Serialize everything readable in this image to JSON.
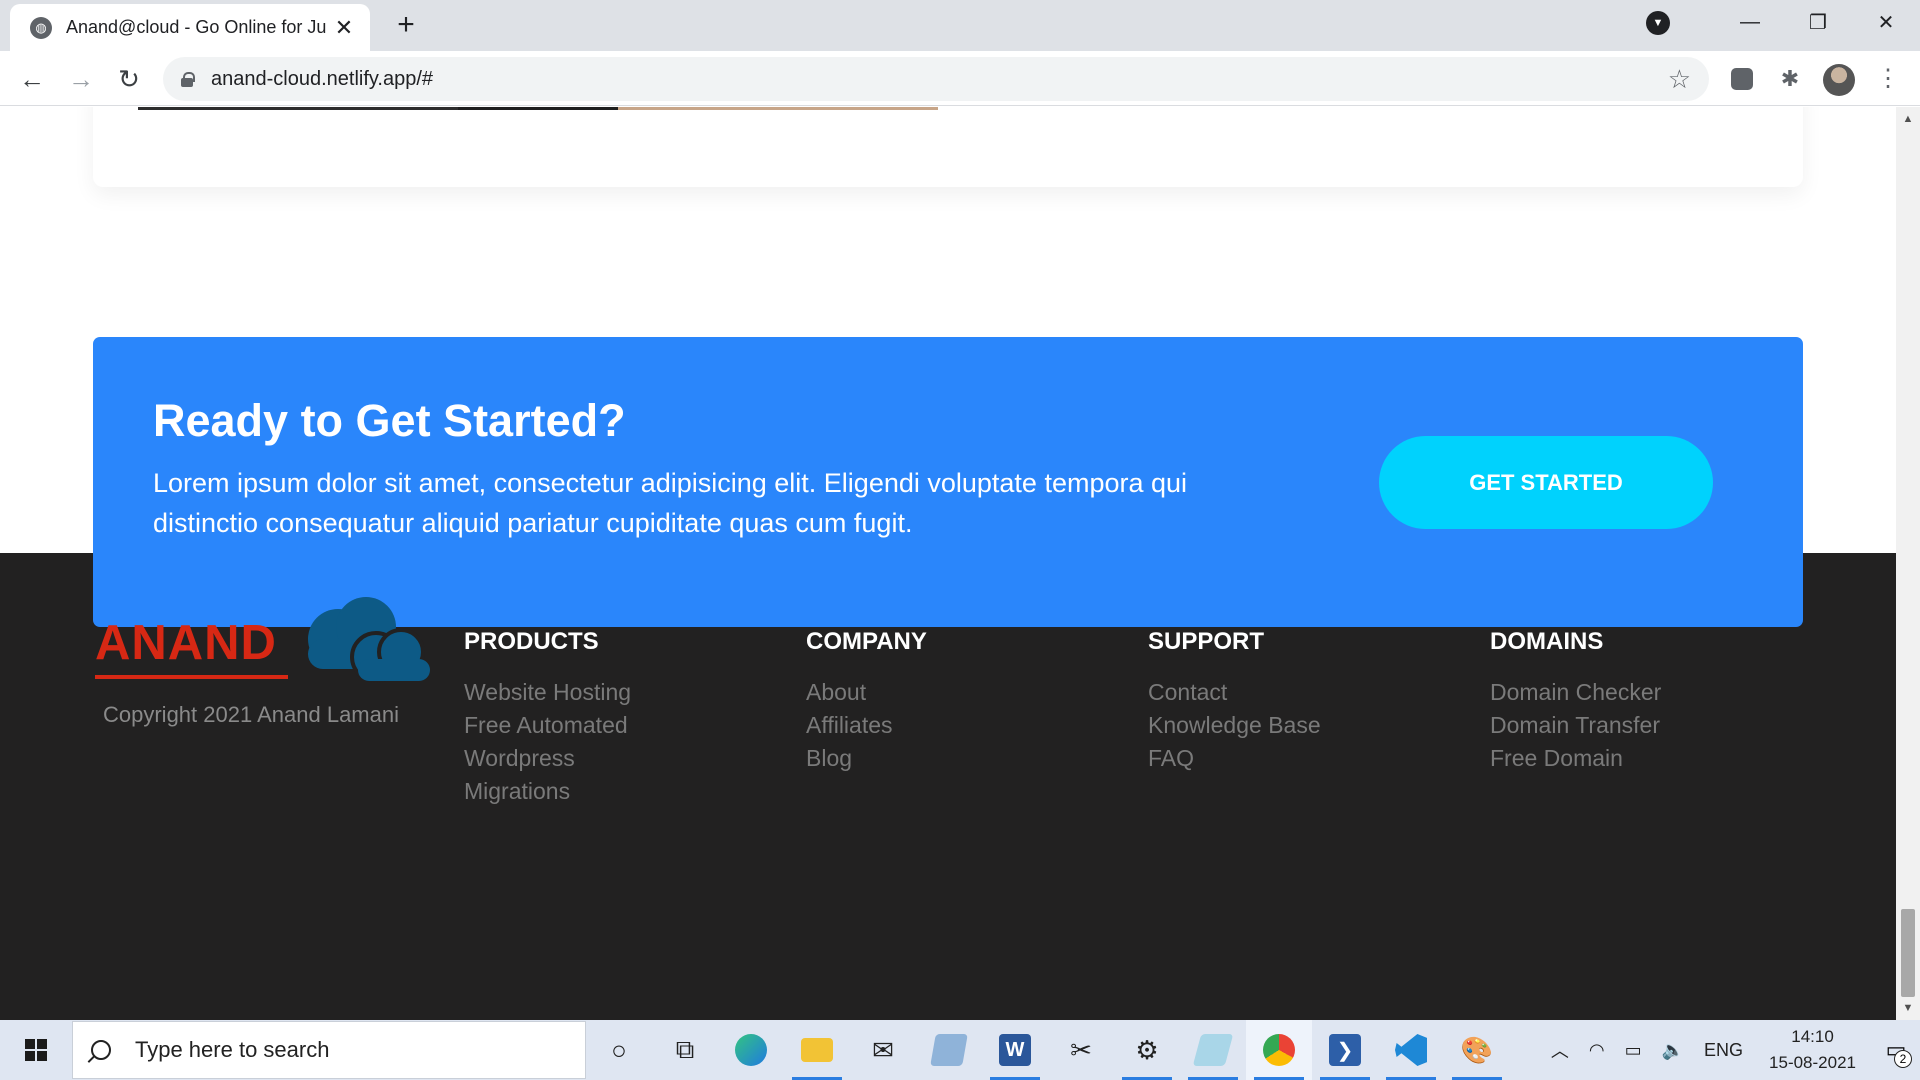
{
  "browser": {
    "tab_title": "Anand@cloud - Go Online for Ju",
    "url": "anand-cloud.netlify.app/#"
  },
  "cta": {
    "title": "Ready to Get Started?",
    "text": "Lorem ipsum dolor sit amet, consectetur adipisicing elit. Eligendi voluptate tempora qui distinctio consequatur aliquid pariatur cupiditate quas cum fugit.",
    "button_label": "GET STARTED"
  },
  "footer": {
    "brand": "ANAND",
    "copyright": "Copyright 2021 Anand Lamani",
    "columns": [
      {
        "heading": "PRODUCTS",
        "links": [
          "Website Hosting",
          "Free Automated",
          "Wordpress",
          "Migrations"
        ]
      },
      {
        "heading": "COMPANY",
        "links": [
          "About",
          "Affiliates",
          "Blog"
        ]
      },
      {
        "heading": "SUPPORT",
        "links": [
          "Contact",
          "Knowledge Base",
          "FAQ"
        ]
      },
      {
        "heading": "DOMAINS",
        "links": [
          "Domain Checker",
          "Domain Transfer",
          "Free Domain"
        ]
      }
    ]
  },
  "taskbar": {
    "search_placeholder": "Type here to search",
    "language": "ENG",
    "time": "14:10",
    "date": "15-08-2021",
    "notification_count": "2"
  },
  "colors": {
    "cta_background": "#2a86fb",
    "cta_button": "#00d2fd",
    "footer_background": "#222121",
    "brand_red": "#d72814",
    "cloud_blue": "#0d5a86"
  }
}
